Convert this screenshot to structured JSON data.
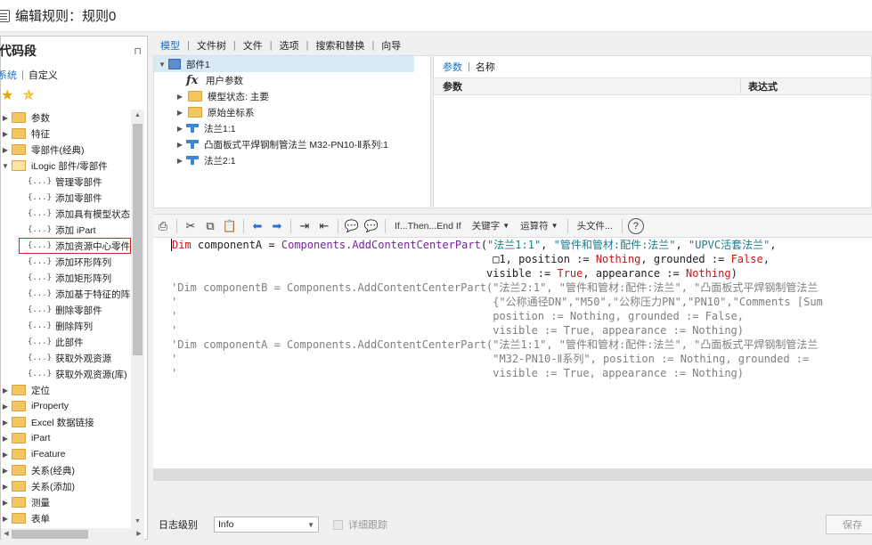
{
  "window": {
    "title": "编辑规则：规则0"
  },
  "left_panel": {
    "title": "代码段",
    "pin": "⊓",
    "tabs": [
      "系统",
      "自定义"
    ],
    "tree": [
      {
        "label": "参数",
        "type": "folder"
      },
      {
        "label": "特征",
        "type": "folder"
      },
      {
        "label": "零部件(经典)",
        "type": "folder"
      },
      {
        "label": "iLogic 部件/零部件",
        "type": "folder-open"
      },
      {
        "label": "管理零部件",
        "type": "item"
      },
      {
        "label": "添加零部件",
        "type": "item"
      },
      {
        "label": "添加具有模型状态的",
        "type": "item"
      },
      {
        "label": "添加 iPart",
        "type": "item"
      },
      {
        "label": "添加资源中心零件",
        "type": "item-selected"
      },
      {
        "label": "添加环形阵列",
        "type": "item"
      },
      {
        "label": "添加矩形阵列",
        "type": "item"
      },
      {
        "label": "添加基于特征的阵列",
        "type": "item"
      },
      {
        "label": "删除零部件",
        "type": "item"
      },
      {
        "label": "删除阵列",
        "type": "item"
      },
      {
        "label": "此部件",
        "type": "item"
      },
      {
        "label": "获取外观资源",
        "type": "item"
      },
      {
        "label": "获取外观资源(库)",
        "type": "item"
      },
      {
        "label": "定位",
        "type": "folder"
      },
      {
        "label": "iProperty",
        "type": "folder"
      },
      {
        "label": "Excel 数据链接",
        "type": "folder"
      },
      {
        "label": "iPart",
        "type": "folder"
      },
      {
        "label": "iFeature",
        "type": "folder"
      },
      {
        "label": "关系(经典)",
        "type": "folder"
      },
      {
        "label": "关系(添加)",
        "type": "folder"
      },
      {
        "label": "测量",
        "type": "folder"
      },
      {
        "label": "表单",
        "type": "folder"
      }
    ],
    "item_prefix": "{...}"
  },
  "top_tabs": [
    "模型",
    "文件树",
    "文件",
    "选项",
    "搜索和替换",
    "向导"
  ],
  "model_tree": [
    {
      "label": "部件1",
      "icon": "part-icon",
      "arrow": "▼",
      "indent": 0
    },
    {
      "label": "用户参数",
      "icon": "fx-icon",
      "arrow": "",
      "indent": 1
    },
    {
      "label": "模型状态: 主要",
      "icon": "folder-icon",
      "arrow": "▶",
      "indent": 1
    },
    {
      "label": "原始坐标系",
      "icon": "folder-icon",
      "arrow": "▶",
      "indent": 1
    },
    {
      "label": "法兰1:1",
      "icon": "pipe-icon",
      "arrow": "▶",
      "indent": 1
    },
    {
      "label": "凸面板式平焊钢制管法兰 M32-PN10-Ⅱ系列:1",
      "icon": "pipe-icon",
      "arrow": "▶",
      "indent": 1
    },
    {
      "label": "法兰2:1",
      "icon": "pipe-icon",
      "arrow": "▶",
      "indent": 1
    }
  ],
  "params": {
    "tabs": [
      "参数",
      "名称"
    ],
    "col_param": "参数",
    "col_expr": "表达式"
  },
  "toolbar": {
    "if_then": "If...Then...End If",
    "keywords": "关键字",
    "operators": "运算符",
    "header_file": "头文件...",
    "help": "?"
  },
  "code_lines": [
    [
      [
        "kw",
        "Dim"
      ],
      [
        "plain",
        " componentA = "
      ],
      [
        "fn",
        "Components.AddContentCenterPart"
      ],
      [
        "plain",
        "("
      ],
      [
        "str",
        "\"法兰1:1\""
      ],
      [
        "plain",
        ", "
      ],
      [
        "str",
        "\"管件和管材:配件:法兰\""
      ],
      [
        "plain",
        ", "
      ],
      [
        "str",
        "\"UPVC活套法兰\""
      ],
      [
        "plain",
        ","
      ]
    ],
    [
      [
        "plain",
        "                                                  □1, position := "
      ],
      [
        "kw",
        "Nothing"
      ],
      [
        "plain",
        ", grounded := "
      ],
      [
        "kw",
        "False"
      ],
      [
        "plain",
        ","
      ]
    ],
    [
      [
        "plain",
        "                                                 visible := "
      ],
      [
        "kw",
        "True"
      ],
      [
        "plain",
        ", appearance := "
      ],
      [
        "kw",
        "Nothing"
      ],
      [
        "plain",
        ")"
      ]
    ],
    [
      [
        "cm",
        "'Dim componentB = Components.AddContentCenterPart(\"法兰2:1\", \"管件和管材:配件:法兰\", \"凸面板式平焊钢制管法兰"
      ]
    ],
    [
      [
        "cm",
        "'                                                 {\"公称通径DN\",\"M50\",\"公称压力PN\",\"PN10\",\"Comments [Sum"
      ]
    ],
    [
      [
        "cm",
        "'                                                 position := Nothing, grounded := False,"
      ]
    ],
    [
      [
        "cm",
        "'                                                 visible := True, appearance := Nothing)"
      ]
    ],
    [
      [
        "cm",
        "'Dim componentA = Components.AddContentCenterPart(\"法兰1:1\", \"管件和管材:配件:法兰\", \"凸面板式平焊钢制管法兰"
      ]
    ],
    [
      [
        "cm",
        "'                                                 \"M32-PN10-Ⅱ系列\", position := Nothing, grounded :="
      ]
    ],
    [
      [
        "cm",
        "'                                                 visible := True, appearance := Nothing)"
      ]
    ]
  ],
  "bottom": {
    "log_label": "日志级别",
    "log_value": "Info",
    "trace_label": "详细跟踪",
    "save_label": "保存"
  }
}
